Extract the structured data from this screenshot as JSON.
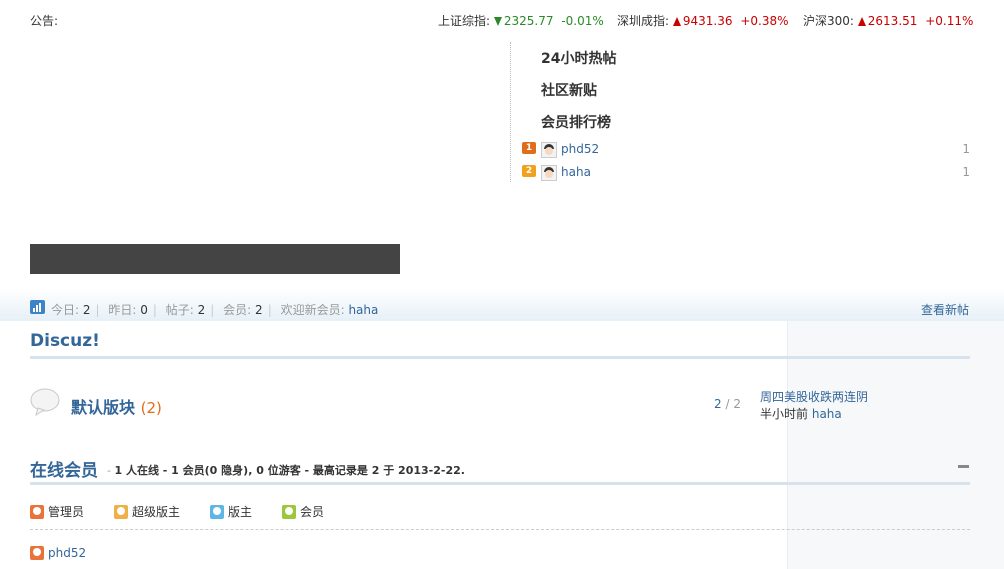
{
  "notice": {
    "label": "公告:"
  },
  "tickers": [
    {
      "label": "上证综指:",
      "value": "2325.77",
      "change": "-0.01%",
      "direction": "down"
    },
    {
      "label": "深圳成指:",
      "value": "9431.36",
      "change": "+0.38%",
      "direction": "up"
    },
    {
      "label": "沪深300:",
      "value": "2613.51",
      "change": "+0.11%",
      "direction": "up"
    }
  ],
  "side": {
    "hot24": "24小时热帖",
    "newposts": "社区新贴",
    "ranking": "会员排行榜",
    "rank_list": [
      {
        "rank": "1",
        "name": "phd52",
        "count": "1"
      },
      {
        "rank": "2",
        "name": "haha",
        "count": "1"
      }
    ]
  },
  "stats": {
    "today_label": "今日:",
    "today": "2",
    "yesterday_label": "昨日:",
    "yesterday": "0",
    "posts_label": "帖子:",
    "posts": "2",
    "members_label": "会员:",
    "members": "2",
    "welcome_label": "欢迎新会员:",
    "newest": "haha",
    "view_new": "查看新帖"
  },
  "category": {
    "title": "Discuz!",
    "forum": {
      "name": "默认版块",
      "today": "(2)",
      "threads": "2",
      "slash": "/",
      "posts": "2",
      "last_title": "周四美股收跌两连阴",
      "last_time": "半小时前",
      "last_user": "haha"
    }
  },
  "online": {
    "title": "在线会员",
    "desc_prefix": "- ",
    "desc": "1 人在线 - 1 会员(0 隐身), 0 位游客 - 最高记录是 2 于 2013-2-22.",
    "legend": [
      {
        "label": "管理员",
        "color": "#e8743a"
      },
      {
        "label": "超级版主",
        "color": "#f0b048"
      },
      {
        "label": "版主",
        "color": "#5fb6e6"
      },
      {
        "label": "会员",
        "color": "#9bc83a"
      }
    ],
    "members": [
      {
        "name": "phd52",
        "color": "#e8743a"
      }
    ]
  },
  "colors": {
    "link": "#336699",
    "down": "#2a8a2a",
    "up": "#c80000",
    "accent": "#e06d1a"
  }
}
